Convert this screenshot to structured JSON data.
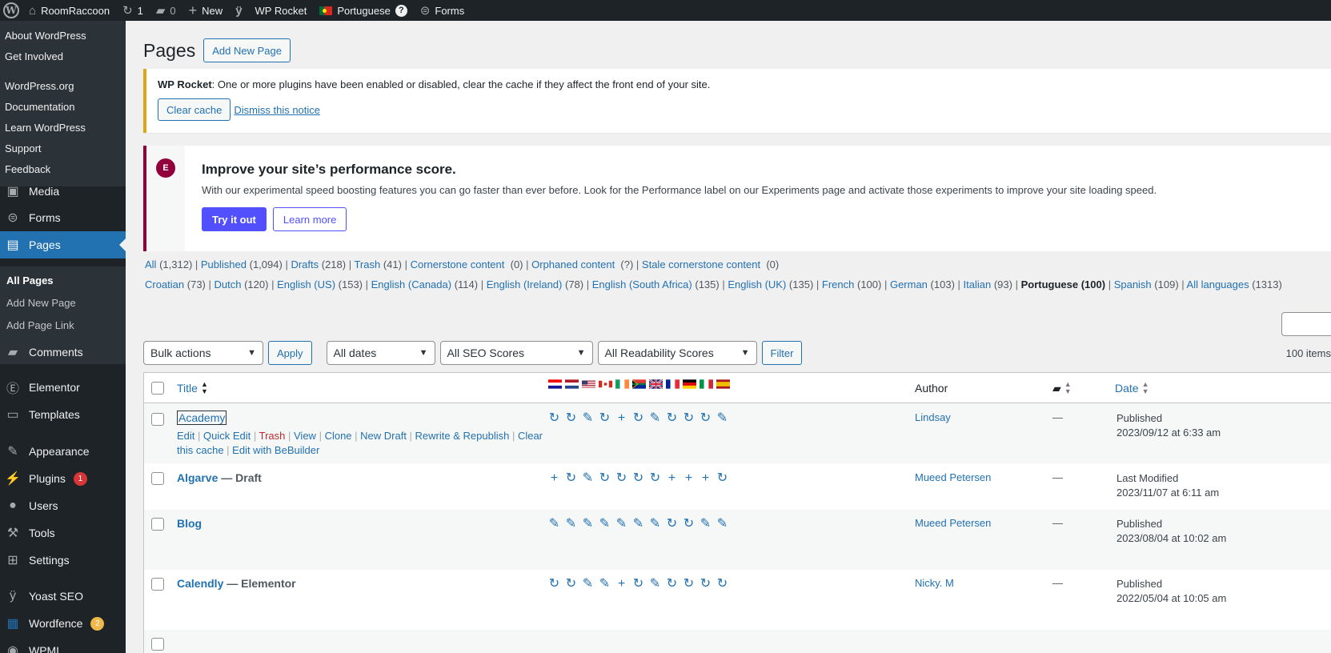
{
  "adminbar": {
    "site_name": "RoomRaccoon",
    "updates_count": "1",
    "comments_count": "0",
    "new_label": "New",
    "wp_rocket": "WP Rocket",
    "language": "Portuguese",
    "help_mark": "?",
    "forms": "Forms"
  },
  "sidebar": {
    "flyout": [
      "About WordPress",
      "Get Involved",
      "WordPress.org",
      "Documentation",
      "Learn WordPress",
      "Support",
      "Feedback"
    ],
    "media": "Media",
    "forms": "Forms",
    "pages": "Pages",
    "submenu": [
      "All Pages",
      "Add New Page",
      "Add Page Link"
    ],
    "comments": "Comments",
    "elementor": "Elementor",
    "templates": "Templates",
    "appearance": "Appearance",
    "plugins": "Plugins",
    "plugins_count": "1",
    "users": "Users",
    "tools": "Tools",
    "settings": "Settings",
    "yoast": "Yoast SEO",
    "wordfence": "Wordfence",
    "wordfence_count": "2",
    "wpml": "WPML"
  },
  "header": {
    "title": "Pages",
    "add_new": "Add New Page"
  },
  "rocket_notice": {
    "strong": "WP Rocket",
    "text": ": One or more plugins have been enabled or disabled, clear the cache if they affect the front end of your site.",
    "clear_cache": "Clear cache",
    "dismiss": "Dismiss this notice"
  },
  "elementor_notice": {
    "logo": "E",
    "title": "Improve your site’s performance score.",
    "desc": "With our experimental speed boosting features you can go faster than ever before. Look for the Performance label on our Experiments page and activate those experiments to improve your site loading speed.",
    "try": "Try it out",
    "learn": "Learn more"
  },
  "status_filters": [
    {
      "label": "All",
      "count": "(1,312)"
    },
    {
      "label": "Published",
      "count": "(1,094)"
    },
    {
      "label": "Drafts",
      "count": "(218)"
    },
    {
      "label": "Trash",
      "count": "(41)"
    },
    {
      "label": "Cornerstone content",
      "count": "(0)"
    },
    {
      "label": "Orphaned content",
      "count": "(?)"
    },
    {
      "label": "Stale cornerstone content",
      "count": "(0)"
    }
  ],
  "language_filters": [
    {
      "label": "Croatian",
      "count": "(73)"
    },
    {
      "label": "Dutch",
      "count": "(120)"
    },
    {
      "label": "English (US)",
      "count": "(153)"
    },
    {
      "label": "English (Canada)",
      "count": "(114)"
    },
    {
      "label": "English (Ireland)",
      "count": "(78)"
    },
    {
      "label": "English (South Africa)",
      "count": "(135)"
    },
    {
      "label": "English (UK)",
      "count": "(135)"
    },
    {
      "label": "French",
      "count": "(100)"
    },
    {
      "label": "German",
      "count": "(103)"
    },
    {
      "label": "Italian",
      "count": "(93)"
    },
    {
      "label": "Portuguese",
      "count": "(100)"
    },
    {
      "label": "Spanish",
      "count": "(109)"
    },
    {
      "label": "All languages",
      "count": "(1313)"
    }
  ],
  "tablenav": {
    "bulk": "Bulk actions",
    "apply": "Apply",
    "dates": "All dates",
    "seo": "All SEO Scores",
    "readability": "All Readability Scores",
    "filter": "Filter",
    "items": "100 items"
  },
  "columns": {
    "title": "Title",
    "author": "Author",
    "date": "Date"
  },
  "flags": [
    "hr",
    "nl",
    "us",
    "ca",
    "ie",
    "za",
    "uk",
    "fr",
    "de",
    "it",
    "es"
  ],
  "rows": [
    {
      "title": "Academy",
      "state": "",
      "author": "Lindsay",
      "comments": "—",
      "status": "Published",
      "date": "2023/09/12 at 6:33 am",
      "icons": [
        "sync",
        "sync",
        "edit",
        "sync",
        "add",
        "sync",
        "edit",
        "sync",
        "sync",
        "sync",
        "edit"
      ],
      "actions": {
        "edit": "Edit",
        "quick": "Quick Edit",
        "trash": "Trash",
        "view": "View",
        "clone": "Clone",
        "new_draft": "New Draft",
        "rewrite": "Rewrite & Republish",
        "clear1": "Clear this",
        "clear2": "cache",
        "bebuilder": "Edit with BeBuilder"
      }
    },
    {
      "title": "Algarve",
      "state": " — Draft",
      "author": "Mueed Petersen",
      "comments": "—",
      "status": "Last Modified",
      "date": "2023/11/07 at 6:11 am",
      "icons": [
        "add",
        "sync",
        "edit",
        "sync",
        "sync",
        "sync",
        "sync",
        "add",
        "add",
        "add",
        "sync"
      ]
    },
    {
      "title": "Blog",
      "state": "",
      "author": "Mueed Petersen",
      "comments": "—",
      "status": "Published",
      "date": "2023/08/04 at 10:02 am",
      "icons": [
        "edit",
        "edit",
        "edit",
        "edit",
        "edit",
        "edit",
        "edit",
        "sync",
        "sync",
        "edit",
        "edit"
      ]
    },
    {
      "title": "Calendly",
      "state": " — Elementor",
      "author": "Nicky. M",
      "comments": "—",
      "status": "Published",
      "date": "2022/05/04 at 10:05 am",
      "icons": [
        "sync",
        "sync",
        "edit",
        "edit",
        "add",
        "sync",
        "edit",
        "sync",
        "sync",
        "sync",
        "sync"
      ]
    }
  ]
}
